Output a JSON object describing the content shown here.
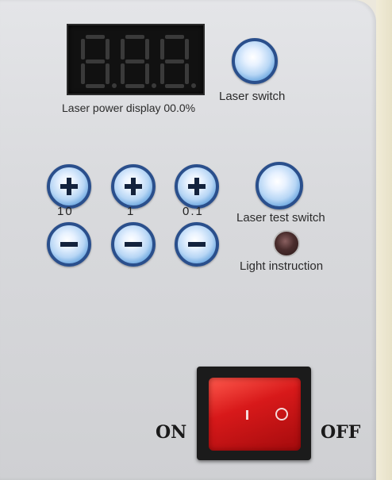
{
  "panel": {
    "display_value": "888",
    "display_label": "Laser power display 00.0%",
    "laser_switch_label": "Laser switch",
    "laser_test_switch_label": "Laser test switch",
    "light_instruction_label": "Light instruction",
    "steps": [
      "10",
      "1",
      "0.1"
    ],
    "plus_icon": "plus-icon",
    "minus_icon": "minus-icon",
    "power_on_label": "ON",
    "power_off_label": "OFF",
    "rocker_on_symbol": "I",
    "rocker_off_symbol": "O"
  },
  "colors": {
    "button_blue": "#6aa6df",
    "button_ring": "#2a4f8c",
    "rocker_red": "#d8191a",
    "display_bg": "#111111"
  }
}
